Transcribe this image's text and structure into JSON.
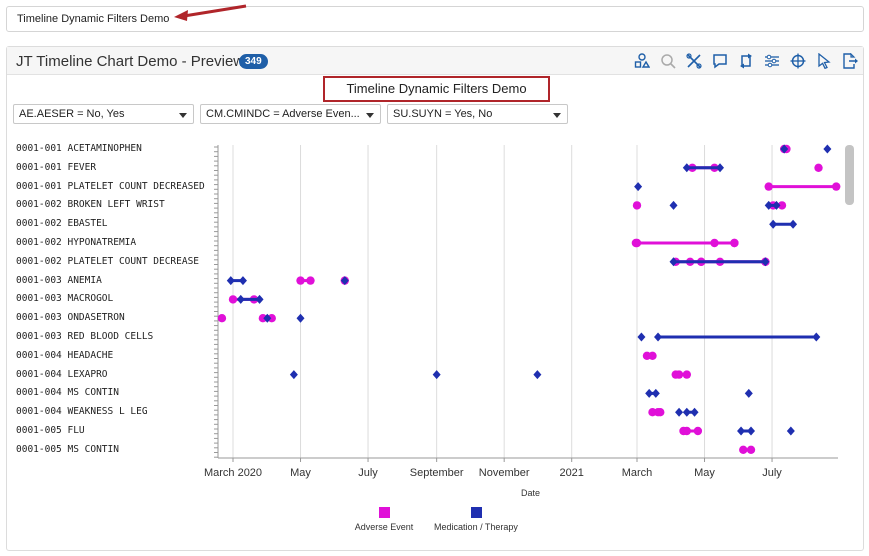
{
  "top_field": {
    "value": "Timeline Dynamic Filters Demo"
  },
  "panel": {
    "title": "JT Timeline Chart Demo - Preview",
    "count": "349"
  },
  "toolbar_icons": [
    "shapes-icon",
    "search-icon",
    "tools-icon",
    "comment-icon",
    "swap-icon",
    "sliders-icon",
    "crosshair-icon",
    "pointer-icon",
    "export-icon"
  ],
  "chart_title": "Timeline Dynamic Filters Demo",
  "filters": [
    {
      "label": "AE.AESER = No, Yes"
    },
    {
      "label": "CM.CMINDC = Adverse Even..."
    },
    {
      "label": "SU.SUYN = Yes, No"
    }
  ],
  "colors": {
    "ae": "#e010d8",
    "cm": "#1f2fb0",
    "badge": "#1f5fa8",
    "highlight": "#b0252a"
  },
  "chart_data": {
    "type": "timeline",
    "xlabel": "Date",
    "x_ticks": [
      "March 2020",
      "May",
      "July",
      "September",
      "November",
      "2021",
      "March",
      "May",
      "July"
    ],
    "x_range": [
      "2020-03-01",
      "2021-08-31"
    ],
    "rows": [
      "0001-001 ACETAMINOPHEN",
      "0001-001 FEVER",
      "0001-001 PLATELET COUNT DECREASED",
      "0001-002 BROKEN LEFT WRIST",
      "0001-002 EBASTEL",
      "0001-002 HYPONATREMIA",
      "0001-002 PLATELET COUNT DECREASE",
      "0001-003 ANEMIA",
      "0001-003 MACROGOL",
      "0001-003 ONDASETRON",
      "0001-003 RED BLOOD CELLS",
      "0001-004 HEADACHE",
      "0001-004 LEXAPRO",
      "0001-004 MS CONTIN",
      "0001-004 WEAKNESS L LEG",
      "0001-005 FLU",
      "0001-005 MS CONTIN"
    ],
    "legend": [
      {
        "name": "Adverse Event",
        "color": "#e010d8"
      },
      {
        "name": "Medication / Therapy",
        "color": "#1f2fb0"
      }
    ],
    "series": [
      {
        "name": "Adverse Event",
        "marker": "circle",
        "events": [
          {
            "row": 0,
            "start": "2021-07-12",
            "end": "2021-07-14"
          },
          {
            "row": 1,
            "start": "2021-08-12"
          },
          {
            "row": 1,
            "start": "2021-04-20",
            "end": "2021-05-10"
          },
          {
            "row": 2,
            "start": "2021-06-28",
            "end": "2021-08-28"
          },
          {
            "row": 3,
            "start": "2021-03-01"
          },
          {
            "row": 3,
            "start": "2021-07-02",
            "end": "2021-07-10"
          },
          {
            "row": 5,
            "start": "2021-02-28",
            "end": "2021-05-28"
          },
          {
            "row": 5,
            "start": "2021-03-01"
          },
          {
            "row": 5,
            "start": "2021-05-10",
            "end": "2021-05-28"
          },
          {
            "row": 6,
            "start": "2021-04-05",
            "end": "2021-06-25"
          },
          {
            "row": 6,
            "start": "2021-06-25"
          },
          {
            "row": 6,
            "start": "2021-04-18",
            "end": "2021-04-28"
          },
          {
            "row": 6,
            "start": "2021-04-28",
            "end": "2021-05-15"
          },
          {
            "row": 7,
            "start": "2020-05-01",
            "end": "2020-05-10"
          },
          {
            "row": 7,
            "start": "2020-06-10"
          },
          {
            "row": 8,
            "start": "2020-03-01",
            "end": "2020-03-20"
          },
          {
            "row": 9,
            "start": "2020-02-20"
          },
          {
            "row": 9,
            "start": "2020-03-28",
            "end": "2020-04-05"
          },
          {
            "row": 11,
            "start": "2021-03-10",
            "end": "2021-03-15"
          },
          {
            "row": 12,
            "start": "2021-04-08",
            "end": "2021-04-15"
          },
          {
            "row": 12,
            "start": "2021-04-05"
          },
          {
            "row": 14,
            "start": "2021-03-15",
            "end": "2021-03-22"
          },
          {
            "row": 14,
            "start": "2021-03-20"
          },
          {
            "row": 15,
            "start": "2021-04-15",
            "end": "2021-04-25"
          },
          {
            "row": 15,
            "start": "2021-04-12"
          },
          {
            "row": 16,
            "start": "2021-06-05",
            "end": "2021-06-12"
          }
        ]
      },
      {
        "name": "Medication / Therapy",
        "marker": "diamond",
        "events": [
          {
            "row": 0,
            "start": "2021-08-20"
          },
          {
            "row": 0,
            "start": "2021-07-12"
          },
          {
            "row": 1,
            "start": "2021-04-15",
            "end": "2021-05-15"
          },
          {
            "row": 2,
            "start": "2021-03-02"
          },
          {
            "row": 3,
            "start": "2021-04-03"
          },
          {
            "row": 3,
            "start": "2021-06-28",
            "end": "2021-07-05"
          },
          {
            "row": 4,
            "start": "2021-07-02",
            "end": "2021-07-20"
          },
          {
            "row": 6,
            "start": "2021-04-03",
            "end": "2021-06-25"
          },
          {
            "row": 7,
            "start": "2020-06-10"
          },
          {
            "row": 7,
            "start": "2020-02-28",
            "end": "2020-03-10"
          },
          {
            "row": 8,
            "start": "2020-03-08",
            "end": "2020-03-25"
          },
          {
            "row": 9,
            "start": "2020-04-01"
          },
          {
            "row": 9,
            "start": "2020-05-01"
          },
          {
            "row": 10,
            "start": "2021-03-05"
          },
          {
            "row": 10,
            "start": "2021-03-20",
            "end": "2021-08-10"
          },
          {
            "row": 12,
            "start": "2020-04-25"
          },
          {
            "row": 12,
            "start": "2020-09-01"
          },
          {
            "row": 12,
            "start": "2020-12-01"
          },
          {
            "row": 13,
            "start": "2021-06-10"
          },
          {
            "row": 13,
            "start": "2021-03-12",
            "end": "2021-03-18"
          },
          {
            "row": 14,
            "start": "2021-04-08"
          },
          {
            "row": 14,
            "start": "2021-04-15",
            "end": "2021-04-22"
          },
          {
            "row": 15,
            "start": "2021-06-03",
            "end": "2021-06-12"
          },
          {
            "row": 15,
            "start": "2021-07-18"
          }
        ]
      }
    ]
  }
}
